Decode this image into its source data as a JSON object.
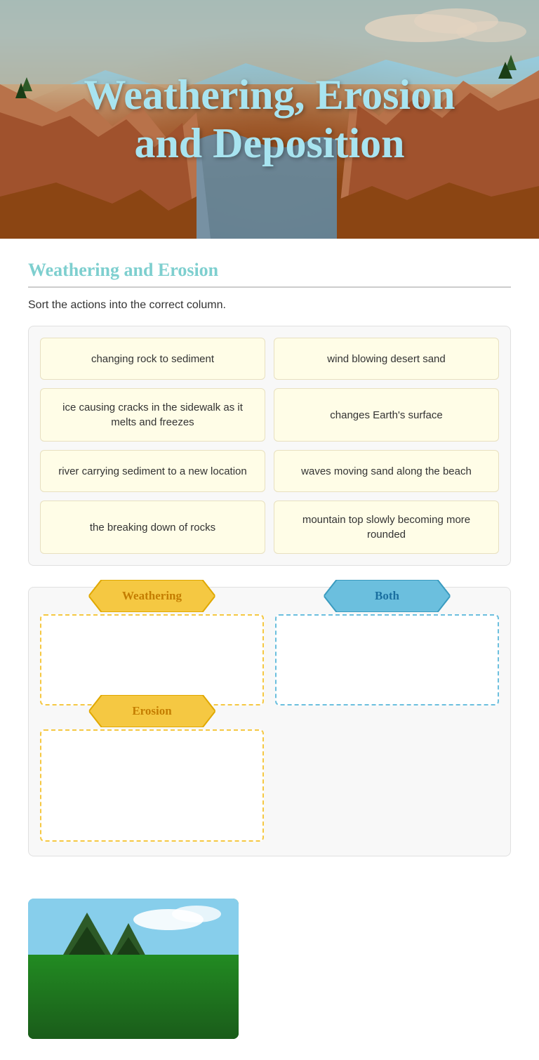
{
  "hero": {
    "title_line1": "Weathering, Erosion",
    "title_line2": "and Deposition"
  },
  "section": {
    "title": "Weathering and Erosion",
    "instructions": "Sort the actions into the correct column."
  },
  "cards": [
    {
      "id": "card-1",
      "text": "changing rock to sediment"
    },
    {
      "id": "card-2",
      "text": "wind blowing desert sand"
    },
    {
      "id": "card-3",
      "text": "ice causing cracks in the sidewalk as it melts and freezes"
    },
    {
      "id": "card-4",
      "text": "changes Earth's surface"
    },
    {
      "id": "card-5",
      "text": "river carrying sediment to a new location"
    },
    {
      "id": "card-6",
      "text": "waves moving sand along the beach"
    },
    {
      "id": "card-7",
      "text": "the breaking down of rocks"
    },
    {
      "id": "card-8",
      "text": "mountain top slowly becoming more rounded"
    }
  ],
  "dropzones": {
    "weathering_label": "Weathering",
    "both_label": "Both",
    "erosion_label": "Erosion"
  }
}
